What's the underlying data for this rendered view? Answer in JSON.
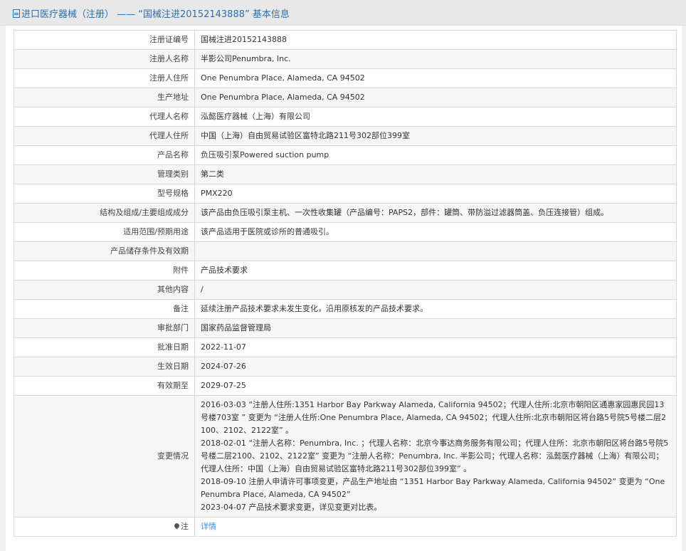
{
  "header": {
    "title": "进口医疗器械（注册） —— “国械注进20152143888” 基本信息"
  },
  "rows": [
    {
      "label": "注册证编号",
      "value": "国械注进20152143888"
    },
    {
      "label": "注册人名称",
      "value": "半影公司Penumbra, Inc."
    },
    {
      "label": "注册人住所",
      "value": "One Penumbra Place, Alameda, CA 94502"
    },
    {
      "label": "生产地址",
      "value": "One Penumbra Place, Alameda, CA 94502"
    },
    {
      "label": "代理人名称",
      "value": "泓懿医疗器械（上海）有限公司"
    },
    {
      "label": "代理人住所",
      "value": "中国（上海）自由贸易试验区富特北路211号302部位399室"
    },
    {
      "label": "产品名称",
      "value": "负压吸引泵Powered suction pump"
    },
    {
      "label": "管理类别",
      "value": "第二类"
    },
    {
      "label": "型号规格",
      "value": "PMX220"
    },
    {
      "label": "结构及组成/主要组成成分",
      "value": "该产品由负压吸引泵主机、一次性收集罐（产品编号：PAPS2，部件：罐筒、带防溢过滤器筒盖、负压连接管）组成。"
    },
    {
      "label": "适用范围/预期用途",
      "value": "该产品适用于医院或诊所的普通吸引。"
    },
    {
      "label": "产品储存条件及有效期",
      "value": ""
    },
    {
      "label": "附件",
      "value": "产品技术要求"
    },
    {
      "label": "其他内容",
      "value": "/"
    },
    {
      "label": "备注",
      "value": "延续注册产品技术要求未发生变化，沿用原核发的产品技术要求。"
    },
    {
      "label": "审批部门",
      "value": "国家药品监督管理局"
    },
    {
      "label": "批准日期",
      "value": "2022-11-07"
    },
    {
      "label": "生效日期",
      "value": "2024-07-26"
    },
    {
      "label": "有效期至",
      "value": "2029-07-25"
    }
  ],
  "changes": {
    "label": "变更情况",
    "entries": [
      "2016-03-03 “注册人住所:1351 Harbor Bay Parkway Alameda, California 94502；代理人住所:北京市朝阳区通惠家园惠民园13号楼703室 ” 变更为 “注册人住所:One Penumbra Place, Alameda, CA 94502；代理人住所:北京市朝阳区将台路5号院5号楼二层2100、2102、2122室” 。",
      "2018-02-01 “注册人名称：Penumbra, Inc. ；代理人名称：北京今事达商务服务有限公司；代理人住所：北京市朝阳区将台路5号院5号楼二层2100、2102、2122室” 变更为 “注册人名称：Penumbra, Inc. 半影公司；代理人名称：泓懿医疗器械（上海）有限公司；代理人住所：中国（上海）自由贸易试验区富特北路211号302部位399室” 。",
      "2018-09-10 注册人申请许可事项变更，产品生产地址由 “1351 Harbor Bay Parkway Alameda, California 94502” 变更为 “One Penumbra Place, Alameda, CA 94502”",
      "2023-04-07 产品技术要求变更，详见变更对比表。"
    ]
  },
  "note": {
    "label": "注",
    "link": "详情"
  }
}
